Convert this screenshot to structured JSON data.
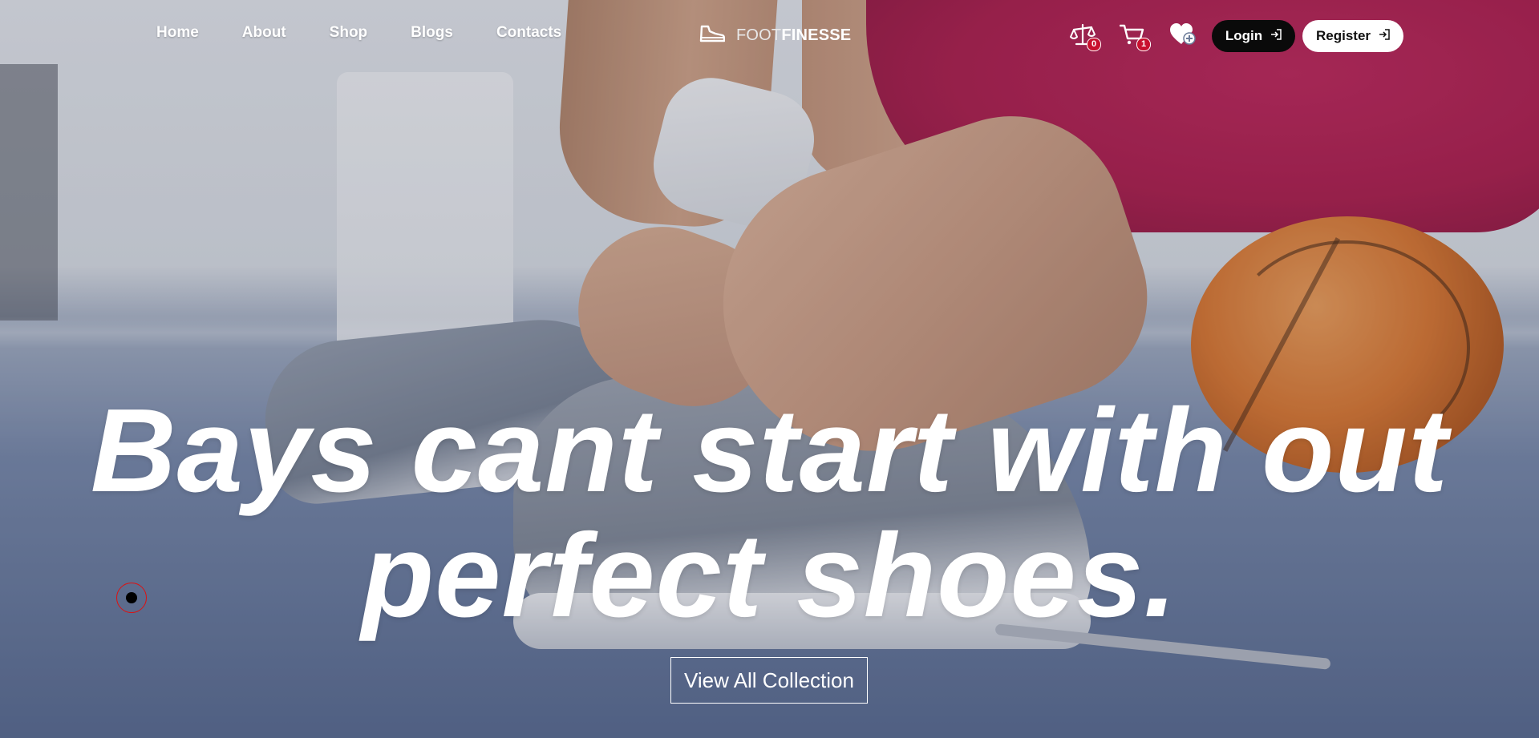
{
  "nav": {
    "links": [
      "Home",
      "About",
      "Shop",
      "Blogs",
      "Contacts"
    ]
  },
  "brand": {
    "prefix": "FOOT",
    "suffix": "FINESSE",
    "logo_icon": "sneaker-icon"
  },
  "header_icons": {
    "compare": {
      "icon": "scale-icon",
      "count": "0"
    },
    "cart": {
      "icon": "cart-icon",
      "count": "1"
    },
    "wishlist": {
      "icon": "heart-plus-icon"
    }
  },
  "auth": {
    "login_label": "Login",
    "register_label": "Register"
  },
  "hero": {
    "headline_line1": "Bays cant start with out",
    "headline_line2": "perfect shoes.",
    "cta_label": "View All Collection"
  },
  "colors": {
    "badge": "#c8102e",
    "login_bg": "#0a0a0a",
    "register_bg": "#ffffff"
  }
}
